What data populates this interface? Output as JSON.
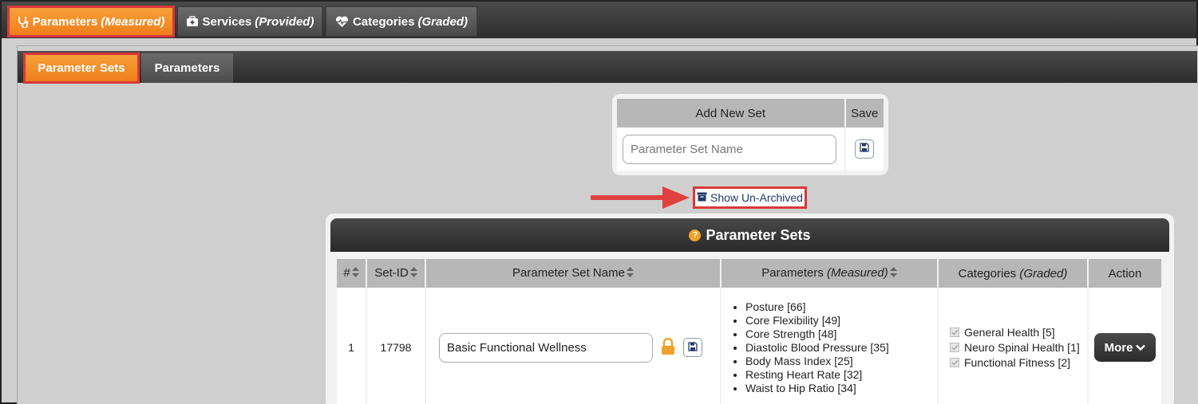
{
  "top_tabs": [
    {
      "label": "Parameters",
      "sub": "(Measured)",
      "icon": "stethoscope-icon",
      "active": true
    },
    {
      "label": "Services",
      "sub": "(Provided)",
      "icon": "medkit-icon",
      "active": false
    },
    {
      "label": "Categories",
      "sub": "(Graded)",
      "icon": "heartbeat-icon",
      "active": false
    }
  ],
  "sub_tabs": [
    {
      "label": "Parameter Sets",
      "active": true
    },
    {
      "label": "Parameters",
      "active": false
    }
  ],
  "add_set": {
    "header_name": "Add New Set",
    "header_save": "Save",
    "placeholder": "Parameter Set Name"
  },
  "show_unarchived": {
    "label": "Show Un-Archived",
    "icon": "archive-icon"
  },
  "sets_panel": {
    "title": "Parameter Sets",
    "columns": {
      "num": "#",
      "setid": "Set-ID",
      "name": "Parameter Set Name",
      "params": "Parameters",
      "params_sub": "(Measured)",
      "cats": "Categories",
      "cats_sub": "(Graded)",
      "action": "Action"
    },
    "rows": [
      {
        "num": "1",
        "setid": "17798",
        "name": "Basic Functional Wellness",
        "parameters": [
          "Posture [66]",
          "Core Flexibility [49]",
          "Core Strength [48]",
          "Diastolic Blood Pressure [35]",
          "Body Mass Index [25]",
          "Resting Heart Rate [32]",
          "Waist to Hip Ratio [34]"
        ],
        "categories": [
          "General Health [5]",
          "Neuro Spinal Health [1]",
          "Functional Fitness [2]"
        ],
        "action_label": "More"
      }
    ]
  },
  "colors": {
    "accent_orange": "#ef7d1a",
    "highlight_red": "#d9383a",
    "dark_bar": "#2e2e2e"
  }
}
